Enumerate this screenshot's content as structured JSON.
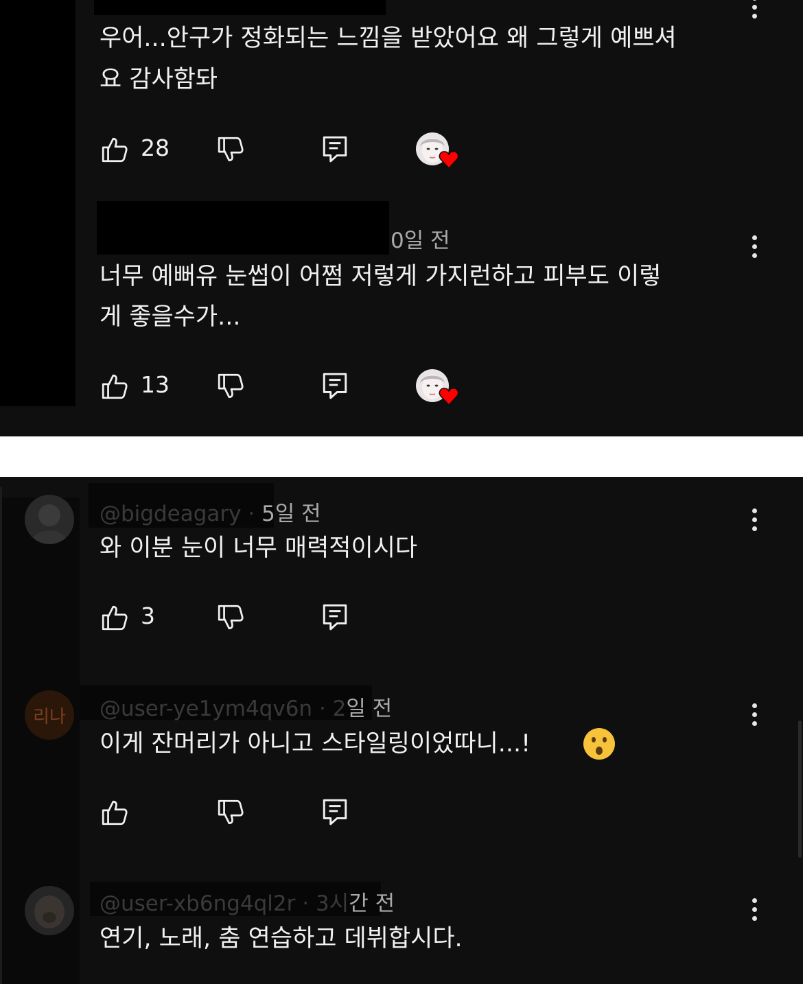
{
  "colors": {
    "panel_background": "#0f0f0f",
    "page_background": "#ffffff",
    "text_primary": "#f1f1f1",
    "text_secondary": "#aaaaaa",
    "heart": "#ff0000"
  },
  "panel1": {
    "comments": [
      {
        "text_line1": "우어...안구가 정화되는 느낌을 받았어요 왜 그렇게 예쁘셔",
        "text_line2": "요 감사함돠",
        "likes": "28",
        "creator_heart": true
      },
      {
        "time": "0일 전",
        "text_line1": "너무 예뻐유 눈썹이 어쩜 저렇게 가지런하고 피부도 이렇",
        "text_line2": "게 좋을수가...",
        "likes": "13",
        "creator_heart": true
      }
    ]
  },
  "panel2": {
    "comments": [
      {
        "handle": "@bigdeagary",
        "separator": "·",
        "time": "5일 전",
        "text": "와 이분 눈이 너무 매력적이시다",
        "likes": "3"
      },
      {
        "avatar_text": "리나",
        "handle": "@user-ye1ym4qv6n",
        "separator": "·",
        "time_faded": "2",
        "time": "일 전",
        "text": "이게 잔머리가 아니고 스타일링이었따니...!",
        "emoji": "hushed-face",
        "likes": ""
      },
      {
        "handle": "@user-xb6ng4ql2r",
        "separator": "·",
        "time_faded": "3시",
        "time": "간 전",
        "text": "연기, 노래, 춤 연습하고 데뷔합시다."
      }
    ]
  },
  "icons": {
    "like": "thumbs-up-outline-icon",
    "dislike": "thumbs-down-outline-icon",
    "reply": "reply-comment-icon",
    "more": "vertical-ellipsis-icon",
    "heart": "creator-heart-icon"
  }
}
